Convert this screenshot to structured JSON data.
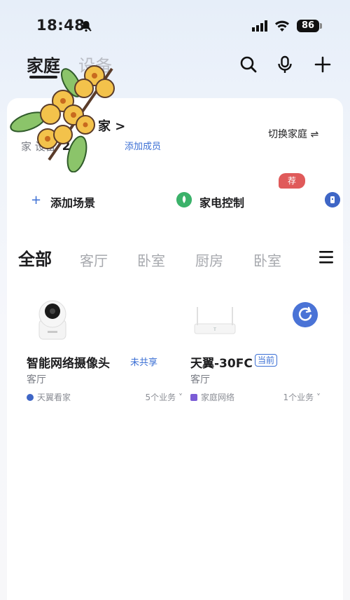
{
  "status_bar": {
    "time": "18:48",
    "battery": "86"
  },
  "header": {
    "tabs": [
      {
        "label": "家庭"
      },
      {
        "label": "设备"
      }
    ],
    "icons": [
      "search-icon",
      "microphone-icon",
      "plus-icon"
    ]
  },
  "home": {
    "title": "家 >",
    "sub_label": "家  设备",
    "device_count": "2",
    "add_member": "添加成员",
    "switch_home": "切换家庭 ⇌"
  },
  "scenes": {
    "add_scene": "添加场景",
    "appliance_control": "家电控制",
    "badge": "荐"
  },
  "rooms": [
    "全部",
    "客厅",
    "卧室",
    "厨房",
    "卧室"
  ],
  "devices": [
    {
      "name": "智能网络摄像头",
      "tag": "未共享",
      "room": "客厅",
      "service": "天翼看家",
      "count": "5个业务 ˅"
    },
    {
      "name": "天翼-30FC",
      "tag": "当前",
      "room": "客厅",
      "service": "家庭网络",
      "count": "1个业务 ˅"
    }
  ],
  "colors": {
    "accent": "#3b6fd4",
    "badge": "#e05a5a",
    "green": "#3bb26a"
  }
}
